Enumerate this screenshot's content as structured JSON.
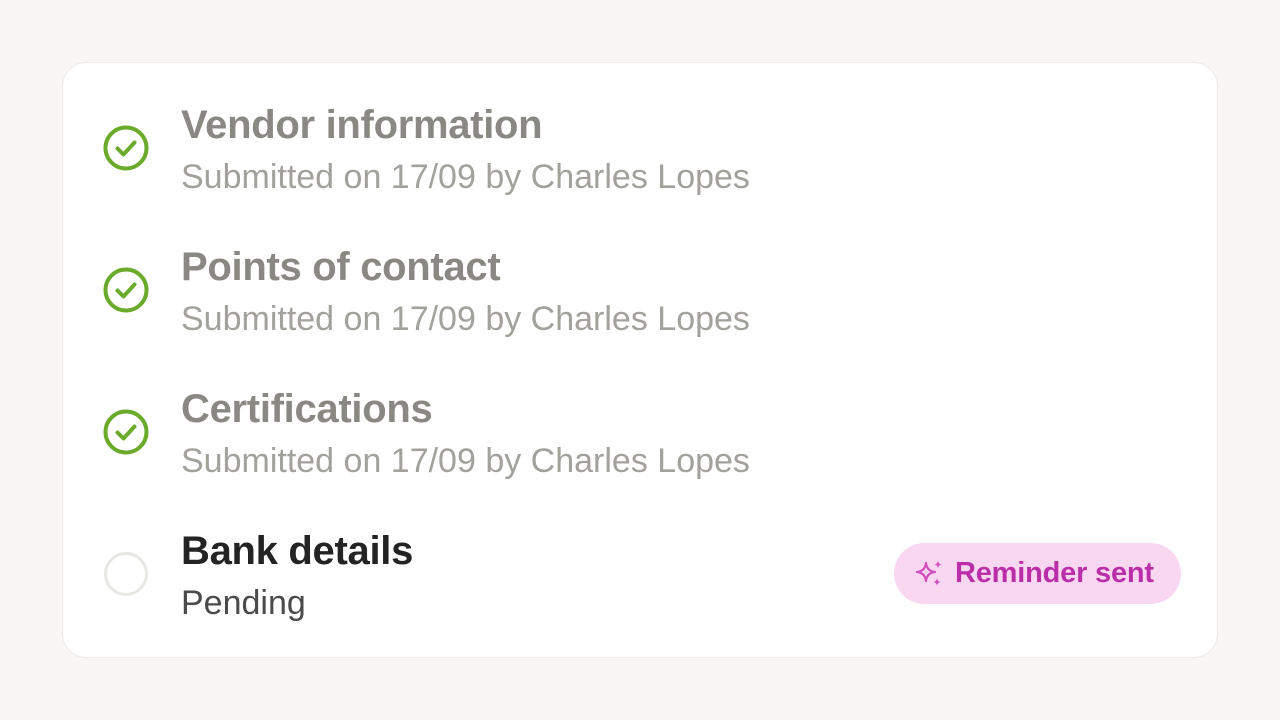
{
  "checklist": {
    "items": [
      {
        "title": "Vendor information",
        "subtitle": "Submitted on 17/09 by Charles Lopes",
        "status": "complete",
        "status_icon": "check-circle-icon"
      },
      {
        "title": "Points of contact",
        "subtitle": "Submitted on 17/09 by Charles Lopes",
        "status": "complete",
        "status_icon": "check-circle-icon"
      },
      {
        "title": "Certifications",
        "subtitle": "Submitted on 17/09 by Charles Lopes",
        "status": "complete",
        "status_icon": "check-circle-icon"
      },
      {
        "title": "Bank details",
        "subtitle": "Pending",
        "status": "pending",
        "status_icon": "empty-circle-icon",
        "badge": {
          "label": "Reminder sent",
          "icon": "sparkles-icon"
        }
      }
    ]
  },
  "colors": {
    "complete_green": "#6aab2b",
    "pending_circle": "#e8e7e4",
    "badge_background": "#fad7f1",
    "badge_text": "#bb2ea9",
    "page_background": "#f8f7f5"
  }
}
